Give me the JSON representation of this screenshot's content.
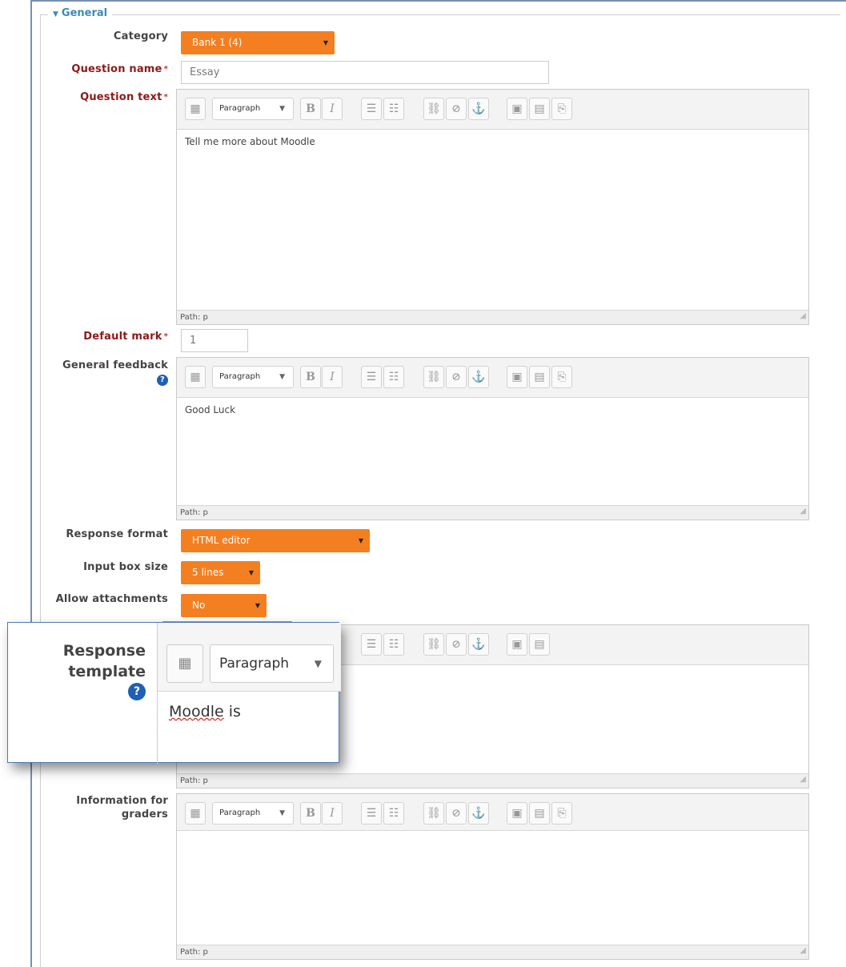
{
  "fieldset": {
    "legend": "General"
  },
  "category": {
    "label": "Category",
    "value": "Bank 1 (4)"
  },
  "question_name": {
    "label": "Question name",
    "value": "Essay"
  },
  "question_text": {
    "label": "Question text",
    "content": "Tell me more about Moodle",
    "path": "Path: p"
  },
  "default_mark": {
    "label": "Default mark",
    "value": "1"
  },
  "general_feedback": {
    "label": "General feedback",
    "content": "Good Luck",
    "path": "Path: p"
  },
  "response_format": {
    "label": "Response format",
    "value": "HTML editor"
  },
  "input_box_size": {
    "label": "Input box size",
    "value": "5 lines"
  },
  "allow_attachments": {
    "label": "Allow attachments",
    "value": "No"
  },
  "response_template": {
    "label": "Response template",
    "content": "Moodle is",
    "path": "Path: p",
    "format": "Paragraph"
  },
  "info_graders": {
    "label": "Information for graders",
    "content": "",
    "path": "Path: p"
  },
  "toolbar": {
    "format": "Paragraph",
    "bold": "B",
    "italic": "I"
  },
  "colors": {
    "accent": "#f47f20",
    "legend": "#3a8bb0",
    "required": "#8b1a1a",
    "help": "#1f5fb4"
  },
  "icons": [
    "expand-triangle-icon",
    "toolbar-toggle-icon",
    "bold-icon",
    "italic-icon",
    "bullet-list-icon",
    "numbered-list-icon",
    "link-icon",
    "unlink-icon",
    "anchor-icon",
    "image-icon",
    "media-icon",
    "paste-icon",
    "help-icon",
    "resize-handle-icon"
  ]
}
